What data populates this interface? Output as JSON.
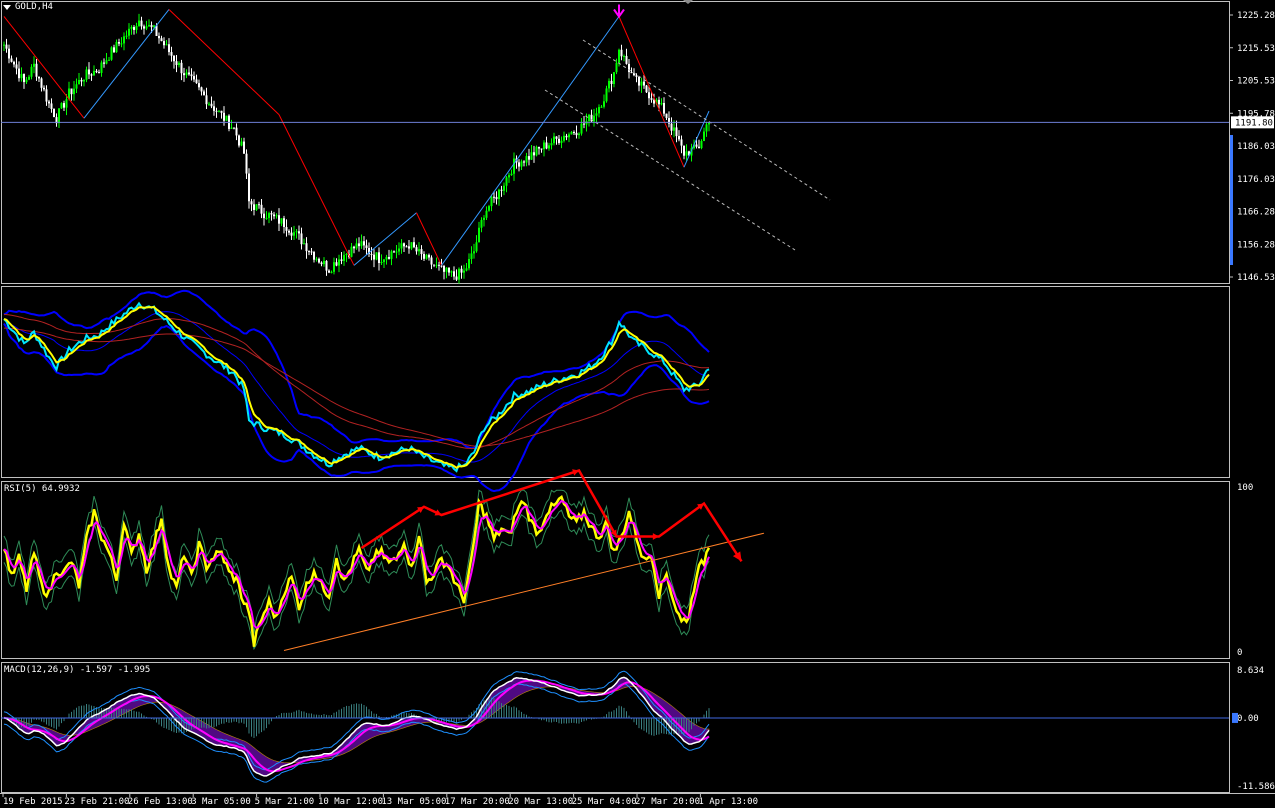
{
  "window": {
    "title": "GOLD,H4"
  },
  "colors": {
    "background": "#000000",
    "frame": "#c0c0c0",
    "bull": "#00ff00",
    "bear": "#ffffff",
    "zigzag_up": "#3399ff",
    "zigzag_down": "#ff0000",
    "price_line": "#6e7fd6",
    "bb": "#0000ff",
    "ma_slow": "#b22222",
    "fast": "#00e5ff",
    "yellow": "#ffff00",
    "magenta": "#ff00ff",
    "rsi_trend": "#ff7f27",
    "annotation": "#ff0000",
    "macd_hist": "#7e0fa8",
    "macd_cloud": "#6a0dad"
  },
  "icons": {
    "symbol_menu": "triangle-down-icon",
    "fractal": "arrow-down-icon"
  },
  "chart_data": [
    {
      "type": "candlestick",
      "name": "GOLD,H4",
      "ylim": [
        1146.53,
        1225.28
      ],
      "yticks": [
        "1225.28",
        "1215.53",
        "1205.53",
        "1195.78",
        "1186.03",
        "1176.03",
        "1166.28",
        "1156.28",
        "1146.53"
      ],
      "current_price": "1191.80",
      "current_value": 1191.8,
      "close_keypoints": [
        [
          0,
          1214
        ],
        [
          8,
          1203
        ],
        [
          12,
          1208
        ],
        [
          18,
          1197
        ],
        [
          21,
          1193
        ],
        [
          26,
          1200
        ],
        [
          32,
          1205
        ],
        [
          38,
          1207
        ],
        [
          42,
          1211
        ],
        [
          48,
          1216
        ],
        [
          54,
          1221
        ],
        [
          60,
          1218
        ],
        [
          66,
          1212
        ],
        [
          72,
          1206
        ],
        [
          78,
          1201
        ],
        [
          84,
          1196
        ],
        [
          88,
          1193
        ],
        [
          92,
          1190
        ],
        [
          96,
          1183
        ],
        [
          98,
          1169
        ],
        [
          104,
          1166
        ],
        [
          112,
          1163
        ],
        [
          118,
          1159
        ],
        [
          124,
          1154
        ],
        [
          130,
          1150
        ],
        [
          134,
          1153
        ],
        [
          142,
          1157
        ],
        [
          150,
          1153
        ],
        [
          156,
          1155
        ],
        [
          162,
          1157
        ],
        [
          168,
          1153
        ],
        [
          172,
          1151
        ],
        [
          176,
          1149
        ],
        [
          180,
          1148
        ],
        [
          184,
          1149
        ],
        [
          188,
          1155
        ],
        [
          192,
          1166
        ],
        [
          198,
          1172
        ],
        [
          204,
          1180
        ],
        [
          210,
          1182
        ],
        [
          216,
          1185
        ],
        [
          224,
          1188
        ],
        [
          230,
          1190
        ],
        [
          236,
          1194
        ],
        [
          240,
          1199
        ],
        [
          244,
          1206
        ],
        [
          246,
          1213
        ],
        [
          248,
          1210
        ],
        [
          252,
          1204
        ],
        [
          258,
          1200
        ],
        [
          264,
          1195
        ],
        [
          268,
          1189
        ],
        [
          272,
          1183
        ],
        [
          276,
          1184
        ],
        [
          278,
          1185
        ],
        [
          282,
          1193
        ]
      ]
    },
    {
      "type": "line",
      "name": "bands",
      "ylim": [
        1146.53,
        1225.28
      ]
    },
    {
      "type": "line",
      "name": "RSI(5)",
      "label": "RSI(5) 64.9932",
      "ylim": [
        0,
        100
      ],
      "yticks": [
        "100",
        "0"
      ],
      "rsi_keypoints": [
        [
          0,
          65
        ],
        [
          3,
          45
        ],
        [
          6,
          57
        ],
        [
          9,
          38
        ],
        [
          12,
          60
        ],
        [
          15,
          40
        ],
        [
          18,
          35
        ],
        [
          21,
          50
        ],
        [
          24,
          48
        ],
        [
          27,
          55
        ],
        [
          30,
          40
        ],
        [
          33,
          68
        ],
        [
          36,
          85
        ],
        [
          39,
          70
        ],
        [
          42,
          60
        ],
        [
          45,
          44
        ],
        [
          48,
          80
        ],
        [
          51,
          58
        ],
        [
          54,
          72
        ],
        [
          57,
          50
        ],
        [
          60,
          65
        ],
        [
          63,
          82
        ],
        [
          66,
          50
        ],
        [
          69,
          38
        ],
        [
          72,
          60
        ],
        [
          75,
          45
        ],
        [
          78,
          65
        ],
        [
          81,
          52
        ],
        [
          84,
          58
        ],
        [
          87,
          60
        ],
        [
          90,
          48
        ],
        [
          93,
          44
        ],
        [
          96,
          30
        ],
        [
          98,
          25
        ],
        [
          100,
          5
        ],
        [
          103,
          20
        ],
        [
          106,
          30
        ],
        [
          109,
          20
        ],
        [
          112,
          37
        ],
        [
          115,
          45
        ],
        [
          118,
          28
        ],
        [
          121,
          40
        ],
        [
          124,
          50
        ],
        [
          127,
          40
        ],
        [
          130,
          35
        ],
        [
          133,
          58
        ],
        [
          136,
          42
        ],
        [
          139,
          52
        ],
        [
          142,
          62
        ],
        [
          145,
          48
        ],
        [
          148,
          58
        ],
        [
          151,
          60
        ],
        [
          154,
          54
        ],
        [
          157,
          56
        ],
        [
          160,
          68
        ],
        [
          163,
          50
        ],
        [
          166,
          72
        ],
        [
          169,
          42
        ],
        [
          172,
          48
        ],
        [
          175,
          56
        ],
        [
          178,
          52
        ],
        [
          181,
          40
        ],
        [
          184,
          32
        ],
        [
          187,
          55
        ],
        [
          190,
          90
        ],
        [
          193,
          82
        ],
        [
          196,
          68
        ],
        [
          199,
          75
        ],
        [
          202,
          70
        ],
        [
          205,
          85
        ],
        [
          208,
          92
        ],
        [
          211,
          78
        ],
        [
          214,
          72
        ],
        [
          217,
          85
        ],
        [
          220,
          88
        ],
        [
          223,
          93
        ],
        [
          226,
          82
        ],
        [
          229,
          78
        ],
        [
          232,
          85
        ],
        [
          235,
          75
        ],
        [
          238,
          70
        ],
        [
          241,
          78
        ],
        [
          244,
          60
        ],
        [
          247,
          70
        ],
        [
          250,
          85
        ],
        [
          253,
          70
        ],
        [
          256,
          55
        ],
        [
          259,
          60
        ],
        [
          262,
          35
        ],
        [
          265,
          48
        ],
        [
          268,
          30
        ],
        [
          271,
          18
        ],
        [
          274,
          22
        ],
        [
          277,
          48
        ],
        [
          280,
          55
        ],
        [
          282,
          65
        ]
      ],
      "trend_line": [
        [
          112,
          0.9
        ],
        [
          304,
          72
        ]
      ],
      "annotation_arrow": [
        [
          143,
          63
        ],
        [
          168,
          88
        ],
        [
          175,
          83
        ],
        [
          230,
          110
        ],
        [
          245,
          70
        ],
        [
          262,
          70
        ],
        [
          280,
          90
        ],
        [
          295,
          55
        ]
      ]
    },
    {
      "type": "bar",
      "name": "MACD(12,26,9)",
      "label": "MACD(12,26,9) -1.597 -1.995",
      "ylim": [
        -11.586,
        8.634
      ],
      "yticks": [
        "8.634",
        "0.00",
        "-11.586"
      ],
      "main": -1.597,
      "signal": -1.995
    }
  ],
  "xaxis": {
    "labels": [
      "19 Feb 2015",
      "23 Feb 21:00",
      "26 Feb 13:00",
      "3 Mar 05:00",
      "5 Mar 21:00",
      "10 Mar 12:00",
      "13 Mar 05:00",
      "17 Mar 20:00",
      "20 Mar 13:00",
      "25 Mar 04:00",
      "27 Mar 20:00",
      "1 Apr 13:00"
    ]
  }
}
